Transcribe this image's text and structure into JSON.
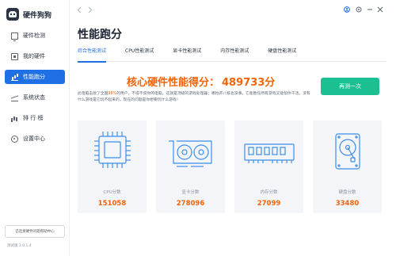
{
  "app": {
    "title": "硬件狗狗"
  },
  "sidebar": {
    "items": [
      {
        "label": "硬件检测",
        "icon": "monitor-icon",
        "active": false
      },
      {
        "label": "我的硬件",
        "icon": "chip-icon",
        "active": false
      },
      {
        "label": "性能跑分",
        "icon": "bar-chart-icon",
        "active": true
      },
      {
        "label": "系统状态",
        "icon": "pulse-icon",
        "active": false
      },
      {
        "label": "排 行 榜",
        "icon": "ranking-icon",
        "active": false
      },
      {
        "label": "设置中心",
        "icon": "gear-icon",
        "active": false
      }
    ],
    "feedback_label": "已连接硬件问题帮助中心",
    "version": "测试版 3.0.1.4"
  },
  "topbar": {
    "back_icon": "chevron-left-icon",
    "forward_icon": "chevron-right-icon"
  },
  "main": {
    "title": "性能跑分",
    "tabs": [
      "综合性能测试",
      "CPU性能测试",
      "显卡性能测试",
      "内存性能测试",
      "硬盘性能测试"
    ],
    "active_tab": 0,
    "score_label": "核心硬件性能得分：",
    "score_value": "489733分",
    "retest_label": "再测一次",
    "desc_before": "此电脑击败了全国",
    "desc_percent": "98%",
    "desc_after": "的用户，不得不说你的电脑，这就是顶级的游戏处理器；哪怕开八核也没事，它能胜任所有游戏又能帮你干活。没有什么游戏是它玩不起来的，现在的问题是你想要玩什么游戏！",
    "cards": [
      {
        "label": "CPU分数",
        "value": "151058",
        "icon": "cpu-icon"
      },
      {
        "label": "显卡分数",
        "value": "278096",
        "icon": "gpu-icon"
      },
      {
        "label": "内存分数",
        "value": "27099",
        "icon": "memory-icon"
      },
      {
        "label": "硬盘分数",
        "value": "33480",
        "icon": "disk-icon"
      }
    ]
  },
  "colors": {
    "accent": "#1f6fe5",
    "score": "#f0640a",
    "button": "#1bbf92",
    "icon_line": "#3b8ee8"
  }
}
